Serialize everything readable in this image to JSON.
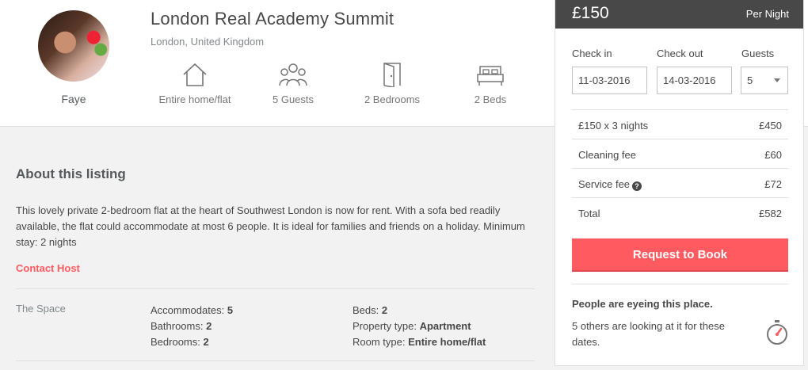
{
  "listing": {
    "title": "London Real Academy Summit",
    "location": "London, United Kingdom",
    "host_name": "Faye",
    "features": [
      {
        "label": "Entire home/flat",
        "icon": "house-icon"
      },
      {
        "label": "5 Guests",
        "icon": "guests-icon"
      },
      {
        "label": "2 Bedrooms",
        "icon": "door-icon"
      },
      {
        "label": "2 Beds",
        "icon": "bed-icon"
      }
    ]
  },
  "about": {
    "title": "About this listing",
    "description": "This lovely private 2-bedroom flat at the heart of Southwest London is now for rent. With a sofa bed readily available, the flat could accommodate at most 6 people. It is ideal for families and friends on a holiday. Minimum stay: 2 nights",
    "contact_label": "Contact Host",
    "space_label": "The Space",
    "space_details": [
      {
        "key": "Accommodates:",
        "value": "5"
      },
      {
        "key": "Bathrooms:",
        "value": "2"
      },
      {
        "key": "Bedrooms:",
        "value": "2"
      },
      {
        "key": "Beds:",
        "value": "2"
      },
      {
        "key": "Property type:",
        "value": "Apartment"
      },
      {
        "key": "Room type:",
        "value": "Entire home/flat"
      }
    ]
  },
  "booking": {
    "price": "£150",
    "per_night": "Per Night",
    "check_in_label": "Check in",
    "check_out_label": "Check out",
    "guests_label": "Guests",
    "check_in_value": "11-03-2016",
    "check_out_value": "14-03-2016",
    "guests_value": "5",
    "fees": [
      {
        "label": "£150 x 3 nights",
        "value": "£450"
      },
      {
        "label": "Cleaning fee",
        "value": "£60"
      },
      {
        "label": "Service fee",
        "value": "£72"
      },
      {
        "label": "Total",
        "value": "£582"
      }
    ],
    "button_label": "Request to Book",
    "eyeing_title": "People are eyeing this place.",
    "eyeing_text": "5 others are looking at it for these dates."
  },
  "colors": {
    "accent": "#ff5a5f",
    "header_dark": "#484848",
    "body_gray": "#f2f2f2"
  }
}
